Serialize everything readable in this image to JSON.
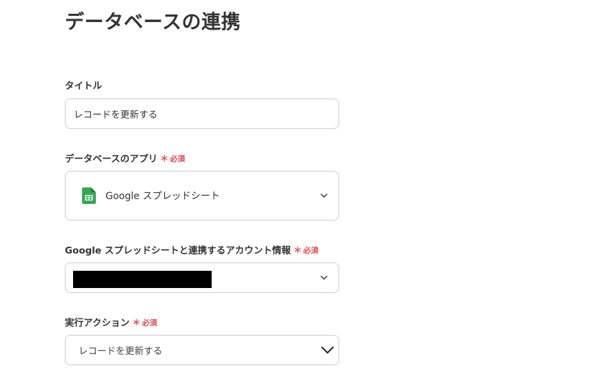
{
  "page": {
    "title": "データベースの連携"
  },
  "fields": {
    "title": {
      "label": "タイトル",
      "value": "レコードを更新する"
    },
    "database_app": {
      "label": "データベースのアプリ",
      "required_mark": "＊",
      "required_label": "必須",
      "selected": "Google スプレッドシート",
      "icon": "google-sheets-icon"
    },
    "account": {
      "label": "Google スプレッドシートと連携するアカウント情報",
      "required_mark": "＊",
      "required_label": "必須"
    },
    "action": {
      "label": "実行アクション",
      "required_mark": "＊",
      "required_label": "必須",
      "selected": "レコードを更新する"
    }
  },
  "colors": {
    "required": "#e5484d",
    "border": "#c8cdd3",
    "sheets_green": "#34a853"
  }
}
